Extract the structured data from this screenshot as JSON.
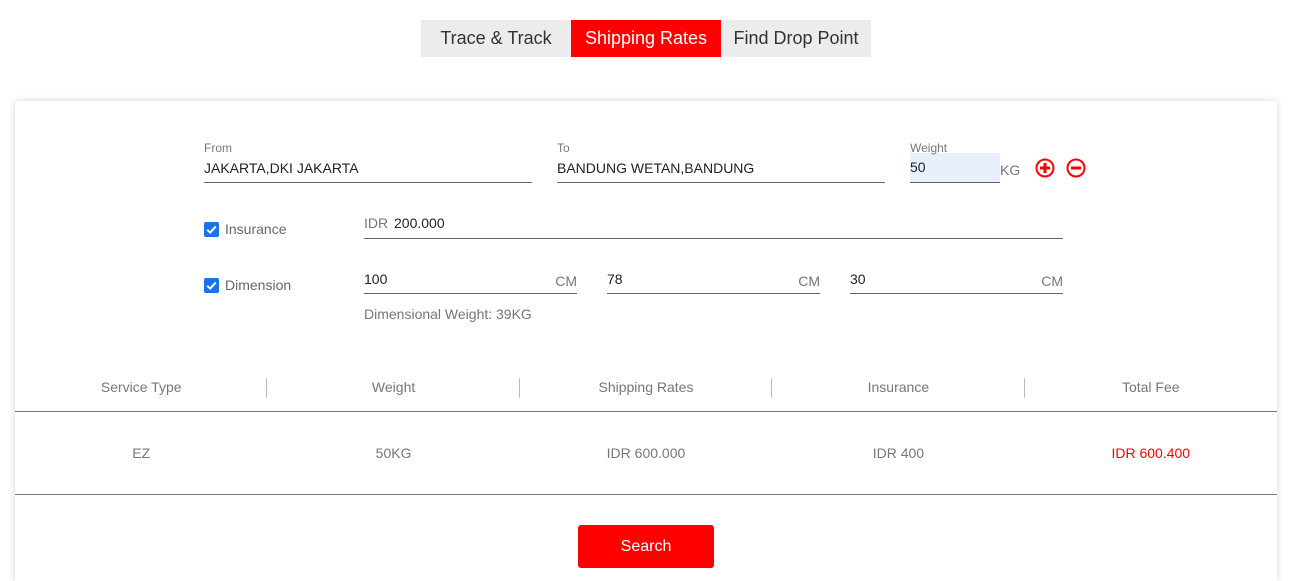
{
  "tabs": [
    {
      "label": "Trace & Track"
    },
    {
      "label": "Shipping Rates"
    },
    {
      "label": "Find Drop Point"
    }
  ],
  "form": {
    "from": {
      "label": "From",
      "value": "JAKARTA,DKI JAKARTA"
    },
    "to": {
      "label": "To",
      "value": "BANDUNG WETAN,BANDUNG"
    },
    "weight": {
      "label": "Weight",
      "value": "50",
      "unit": "KG"
    },
    "insurance": {
      "checkbox_label": "Insurance",
      "checked": true,
      "prefix": "IDR",
      "value": "200.000"
    },
    "dimension": {
      "checkbox_label": "Dimension",
      "checked": true,
      "length": {
        "value": "100",
        "unit": "CM"
      },
      "width": {
        "value": "78",
        "unit": "CM"
      },
      "height": {
        "value": "30",
        "unit": "CM"
      },
      "dimensional_weight": "Dimensional Weight: 39KG"
    }
  },
  "table": {
    "headers": [
      "Service Type",
      "Weight",
      "Shipping Rates",
      "Insurance",
      "Total Fee"
    ],
    "rows": [
      [
        "EZ",
        "50KG",
        "IDR 600.000",
        "IDR 400",
        "IDR 600.400"
      ]
    ]
  },
  "search_label": "Search",
  "colors": {
    "accent": "#ff0000",
    "checkbox": "#1a73e8",
    "tab_inactive": "#ececec"
  }
}
